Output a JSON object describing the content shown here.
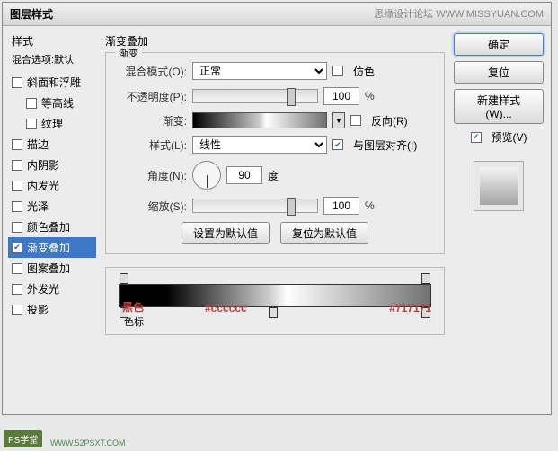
{
  "window": {
    "title": "图层样式",
    "watermark": "思缘设计论坛 WWW.MISSYUAN.COM"
  },
  "sidebar": {
    "title": "样式",
    "subtitle": "混合选项:默认",
    "items": [
      {
        "label": "斜面和浮雕",
        "checked": false
      },
      {
        "label": "等高线",
        "checked": false,
        "indent": true
      },
      {
        "label": "纹理",
        "checked": false,
        "indent": true
      },
      {
        "label": "描边",
        "checked": false
      },
      {
        "label": "内阴影",
        "checked": false
      },
      {
        "label": "内发光",
        "checked": false
      },
      {
        "label": "光泽",
        "checked": false
      },
      {
        "label": "颜色叠加",
        "checked": false
      },
      {
        "label": "渐变叠加",
        "checked": true,
        "selected": true
      },
      {
        "label": "图案叠加",
        "checked": false
      },
      {
        "label": "外发光",
        "checked": false
      },
      {
        "label": "投影",
        "checked": false
      }
    ]
  },
  "panel": {
    "title": "渐变叠加",
    "legend": "渐变",
    "blend_label": "混合模式(O):",
    "blend_value": "正常",
    "dither": "仿色",
    "opacity_label": "不透明度(P):",
    "opacity_value": "100",
    "pct": "%",
    "gradient_label": "渐变:",
    "reverse": "反向(R)",
    "style_label": "样式(L):",
    "style_value": "线性",
    "align": "与图层对齐(I)",
    "angle_label": "角度(N):",
    "angle_value": "90",
    "deg": "度",
    "scale_label": "缩放(S):",
    "scale_value": "100",
    "btn_default": "设置为默认值",
    "btn_reset": "复位为默认值"
  },
  "right": {
    "ok": "确定",
    "cancel": "复位",
    "newstyle": "新建样式(W)...",
    "preview": "预览(V)"
  },
  "gradient": {
    "stop1": "黑色",
    "stop2": "#cccccc",
    "stop3": "#717171",
    "footer": "色标"
  },
  "footer": {
    "logo": "PS学堂",
    "url": "WWW.52PSXT.COM"
  }
}
